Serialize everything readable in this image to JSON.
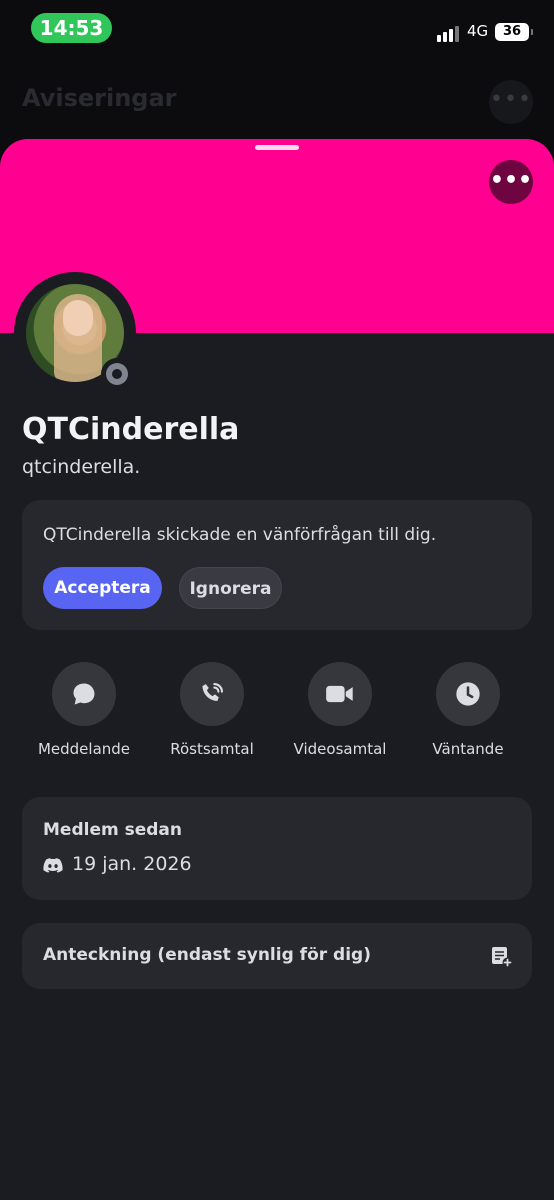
{
  "status_bar": {
    "time": "14:53",
    "network": "4G",
    "battery": "36"
  },
  "background": {
    "title": "Aviseringar",
    "more_label": "•••"
  },
  "profile": {
    "more_label": "•••",
    "display_name": "QTCinderella",
    "username": "qtcinderella.",
    "banner_color": "#ff0091"
  },
  "friend_request": {
    "text": "QTCinderella skickade en vänförfrågan till dig.",
    "accept_label": "Acceptera",
    "ignore_label": "Ignorera"
  },
  "actions": [
    {
      "label": "Meddelande",
      "icon": "message-bubble-icon"
    },
    {
      "label": "Röstsamtal",
      "icon": "phone-icon"
    },
    {
      "label": "Videosamtal",
      "icon": "video-camera-icon"
    },
    {
      "label": "Väntande",
      "icon": "clock-icon"
    }
  ],
  "member_since": {
    "title": "Medlem sedan",
    "date": "19 jan. 2026",
    "icon": "discord-icon"
  },
  "note": {
    "label": "Anteckning (endast synlig för dig)",
    "icon": "add-note-icon"
  },
  "colors": {
    "accent": "#5865f2",
    "card": "#27282e",
    "sheet": "#1b1c21"
  }
}
